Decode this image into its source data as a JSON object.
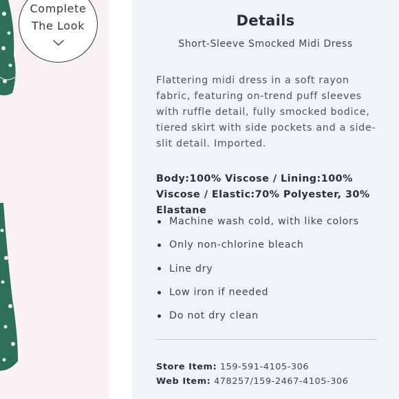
{
  "complete_look": {
    "line1": "Complete",
    "line2": "The Look",
    "icon": "chevron-down-icon"
  },
  "details": {
    "title": "Details",
    "product_name": "Short-Sleeve Smocked Midi Dress",
    "description": "Flattering midi dress in a soft rayon fabric, featuring on-trend puff sleeves with ruffle detail, fully smocked bodice, tiered skirt with side pockets and a side-slit detail. Imported.",
    "materials": "Body:100% Viscose / Lining:100% Viscose / Elastic:70% Polyester, 30% Elastane",
    "care": [
      "Machine wash cold, with like colors",
      "Only non-chlorine bleach",
      "Line dry",
      "Low iron if needed",
      "Do not dry clean"
    ],
    "store_item_label": "Store Item:",
    "store_item_value": "159-591-4105-306",
    "web_item_label": "Web Item:",
    "web_item_value": "478257/159-2467-4105-306"
  },
  "colors": {
    "panel_bg": "#f0f3f7",
    "image_bg": "#fbf3f3",
    "dress_green": "#2e6f5a",
    "text_dark": "#27313d"
  }
}
